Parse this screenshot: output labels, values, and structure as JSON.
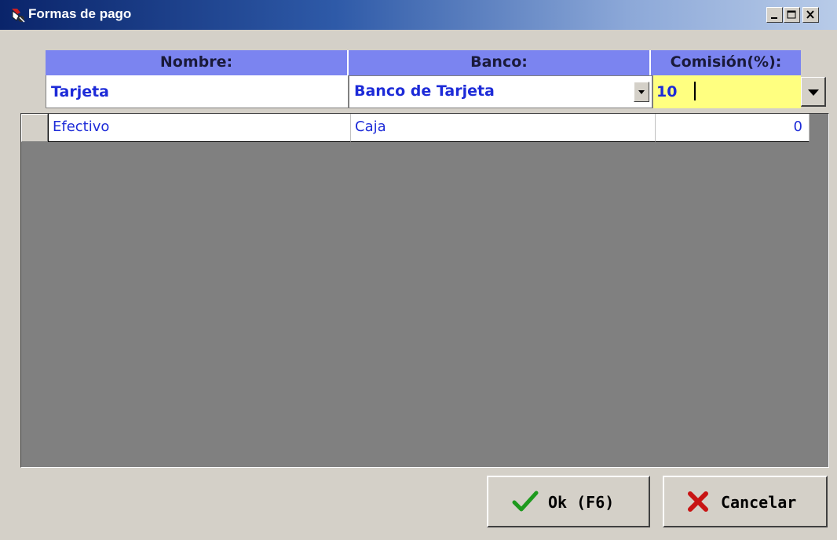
{
  "window": {
    "title": "Formas de pago",
    "controls": [
      "minimize-icon",
      "maximize-icon",
      "close-icon"
    ]
  },
  "grid": {
    "columns": [
      "Nombre:",
      "Banco:",
      "Comisión(%):"
    ],
    "edit_row": {
      "nombre": "Tarjeta",
      "banco": "Banco de Tarjeta",
      "comision": "10"
    },
    "rows": [
      {
        "nombre": "Efectivo",
        "banco": "Caja",
        "comision": "0"
      }
    ]
  },
  "buttons": {
    "ok_label": "Ok (F6)",
    "cancel_label": "Cancelar"
  },
  "colors": {
    "header_bg": "#7b84f0",
    "text_blue": "#1d2bd8",
    "highlight": "#ffff80",
    "grid_bg": "#808080",
    "ok_icon": "#1e9a1e",
    "cancel_icon": "#c81414"
  }
}
